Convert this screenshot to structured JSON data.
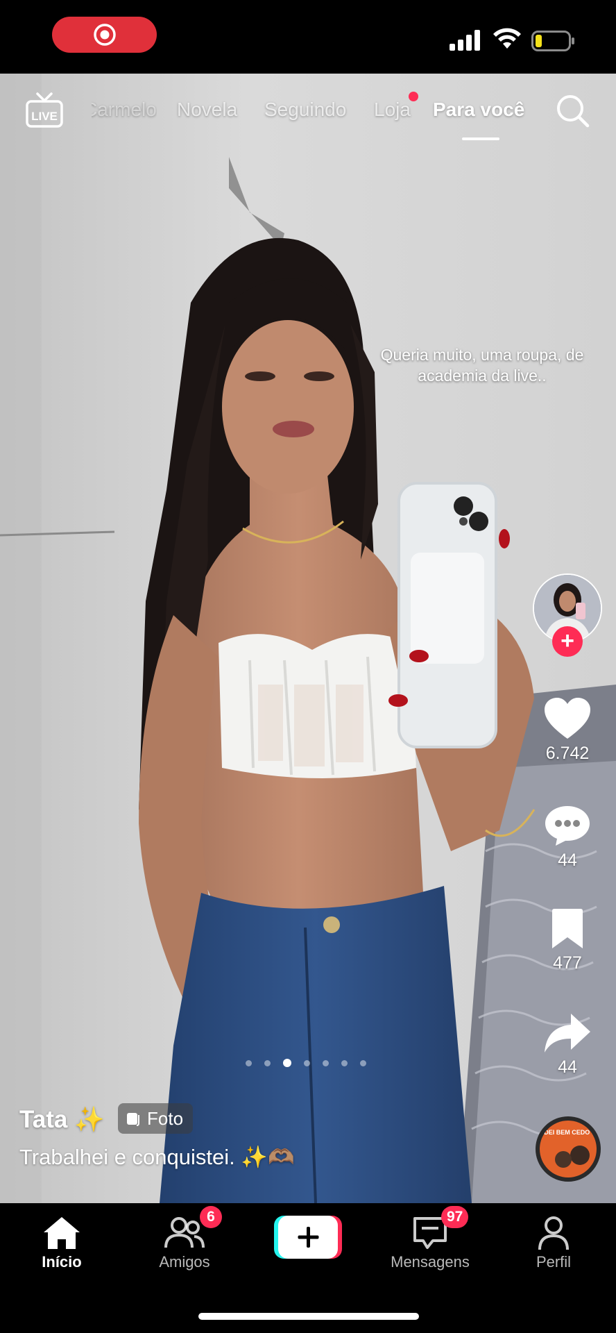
{
  "status_bar": {
    "recording_icon": "record-icon",
    "signal_icon": "cellular-signal-icon",
    "wifi_icon": "wifi-icon",
    "battery_icon": "battery-low-icon",
    "record_color": "#e0303a"
  },
  "top_nav": {
    "live_label": "LIVE",
    "tabs": [
      {
        "label": "Carmelo"
      },
      {
        "label": "Novela"
      },
      {
        "label": "Seguindo"
      },
      {
        "label": "Loja"
      },
      {
        "label": "Para você"
      }
    ],
    "active_tab": "Para você",
    "search_icon": "search-icon"
  },
  "post": {
    "overlay_text": "Queria muito, uma roupa, de academia da live..",
    "username": "Tata ✨",
    "type_badge": "Foto",
    "caption": "Trabalhei e conquistei. ✨🫶🏽",
    "slides_total": 7,
    "slide_active": 3
  },
  "actions": {
    "likes": "6.742",
    "comments": "44",
    "saves": "477",
    "shares": "44",
    "follow_symbol": "+"
  },
  "music_disc_text": "ACORDEI BEM CEDO",
  "bottom_nav": {
    "items": [
      {
        "label": "Início",
        "icon": "home-icon"
      },
      {
        "label": "Amigos",
        "icon": "friends-icon",
        "badge": "6"
      },
      {
        "label": "",
        "icon": "create-plus-icon"
      },
      {
        "label": "Mensagens",
        "icon": "inbox-icon",
        "badge": "97"
      },
      {
        "label": "Perfil",
        "icon": "profile-icon"
      }
    ],
    "create_symbol": "+"
  },
  "colors": {
    "accent": "#fe2c55",
    "cyan": "#25f4ee",
    "background": "#000000"
  }
}
